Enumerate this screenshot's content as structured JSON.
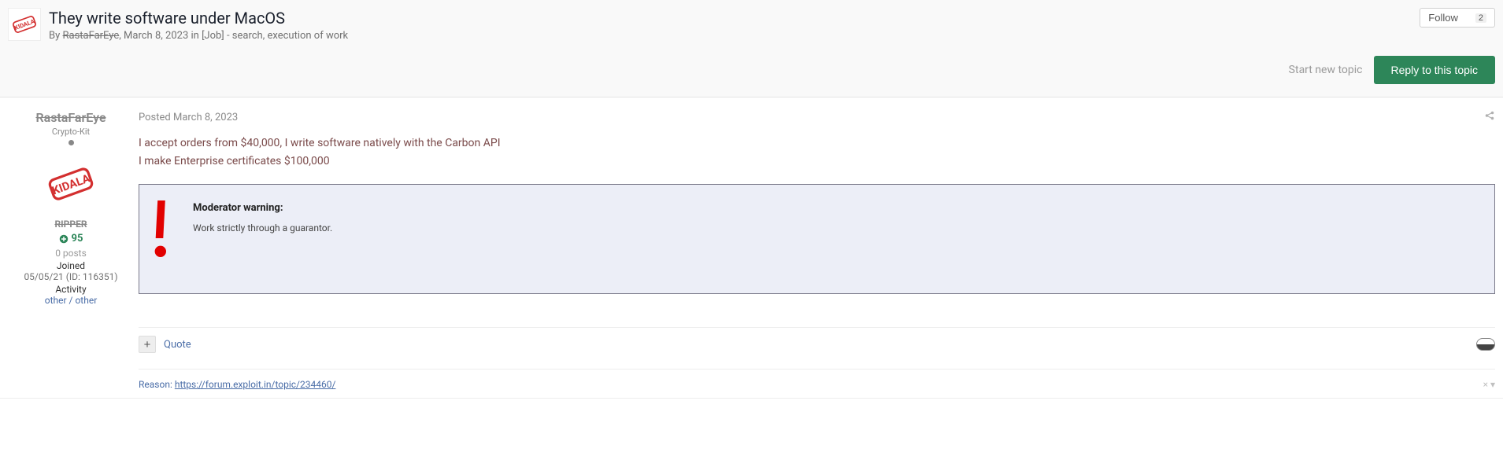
{
  "header": {
    "title": "They write software under MacOS",
    "by_prefix": "By",
    "author": "RastaFarEye",
    "date": "March 8, 2023",
    "in_word": "in",
    "forum": "[Job] - search, execution of work",
    "follow_label": "Follow",
    "follow_count": "2",
    "start_topic": "Start new topic",
    "reply_button": "Reply to this topic"
  },
  "author_panel": {
    "name": "RastaFarEye",
    "group": "Crypto-Kit",
    "tag": "RIPPER",
    "rep": "95",
    "posts": "0 posts",
    "joined_label": "Joined",
    "joined_value": "05/05/21 (ID: 116351)",
    "activity_label": "Activity",
    "activity_value": "other / other"
  },
  "post": {
    "posted_prefix": "Posted",
    "posted_date": "March 8, 2023",
    "post_number_label": "",
    "body_line1": "I accept orders from $40,000, I write software natively with the Carbon API",
    "body_line2": "I make Enterprise certificates $100,000",
    "warning_title": "Moderator warning:",
    "warning_text": "Work strictly through a guarantor.",
    "quote_label": "Quote",
    "reason_label": "Reason: ",
    "reason_link_text": "https://forum.exploit.in/topic/234460/",
    "sig_collapse": "× ▾"
  },
  "colors": {
    "accent_green": "#2d8659",
    "link_blue": "#4a6da7",
    "ripper_red": "#d32f2f"
  }
}
